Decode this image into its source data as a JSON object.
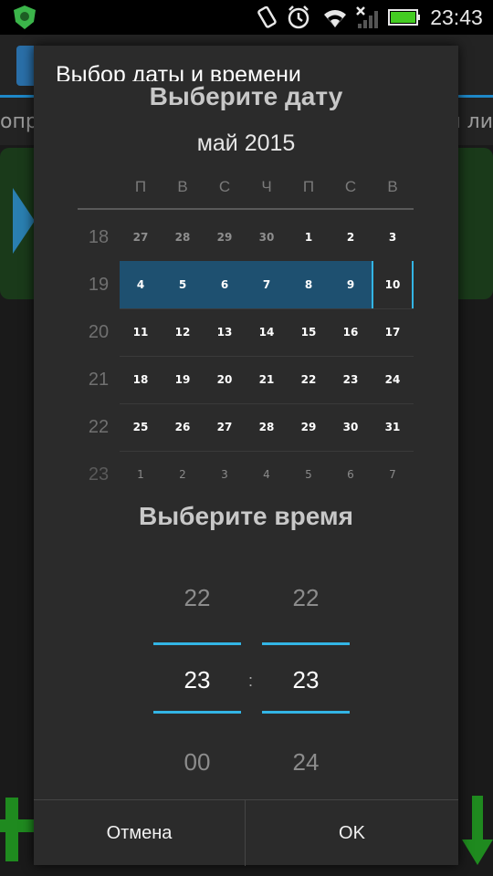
{
  "status_bar": {
    "time": "23:43",
    "icons": [
      "android-shield-icon",
      "vibrate-icon",
      "alarm-icon",
      "wifi-icon",
      "no-signal-icon",
      "battery-icon"
    ],
    "colors": {
      "shield": "#3bb54a",
      "battery": "#44cc22"
    }
  },
  "background_app": {
    "tabs_left": "опр",
    "tabs_right": "и ли"
  },
  "dialog": {
    "title": "Выбор даты и времени",
    "date_section_title": "Выберите дату",
    "month_label": "май 2015",
    "weekdays": [
      "П",
      "В",
      "С",
      "Ч",
      "П",
      "С",
      "В"
    ],
    "weeks": [
      {
        "num": "18",
        "days": [
          "27",
          "28",
          "29",
          "30",
          "1",
          "2",
          "3"
        ]
      },
      {
        "num": "19",
        "days": [
          "4",
          "5",
          "6",
          "7",
          "8",
          "9",
          "10"
        ]
      },
      {
        "num": "20",
        "days": [
          "11",
          "12",
          "13",
          "14",
          "15",
          "16",
          "17"
        ]
      },
      {
        "num": "21",
        "days": [
          "18",
          "19",
          "20",
          "21",
          "22",
          "23",
          "24"
        ]
      },
      {
        "num": "22",
        "days": [
          "25",
          "26",
          "27",
          "28",
          "29",
          "30",
          "31"
        ]
      },
      {
        "num": "23",
        "days": [
          "1",
          "2",
          "3",
          "4",
          "5",
          "6",
          "7"
        ]
      }
    ],
    "selected_day": "10",
    "time_section_title": "Выберите время",
    "hour": {
      "prev": "22",
      "current": "23",
      "next": "00"
    },
    "minute": {
      "prev": "22",
      "current": "23",
      "next": "24"
    },
    "time_separator": ":",
    "cancel_label": "Отмена",
    "ok_label": "OK",
    "accent_color": "#33b5e5"
  }
}
